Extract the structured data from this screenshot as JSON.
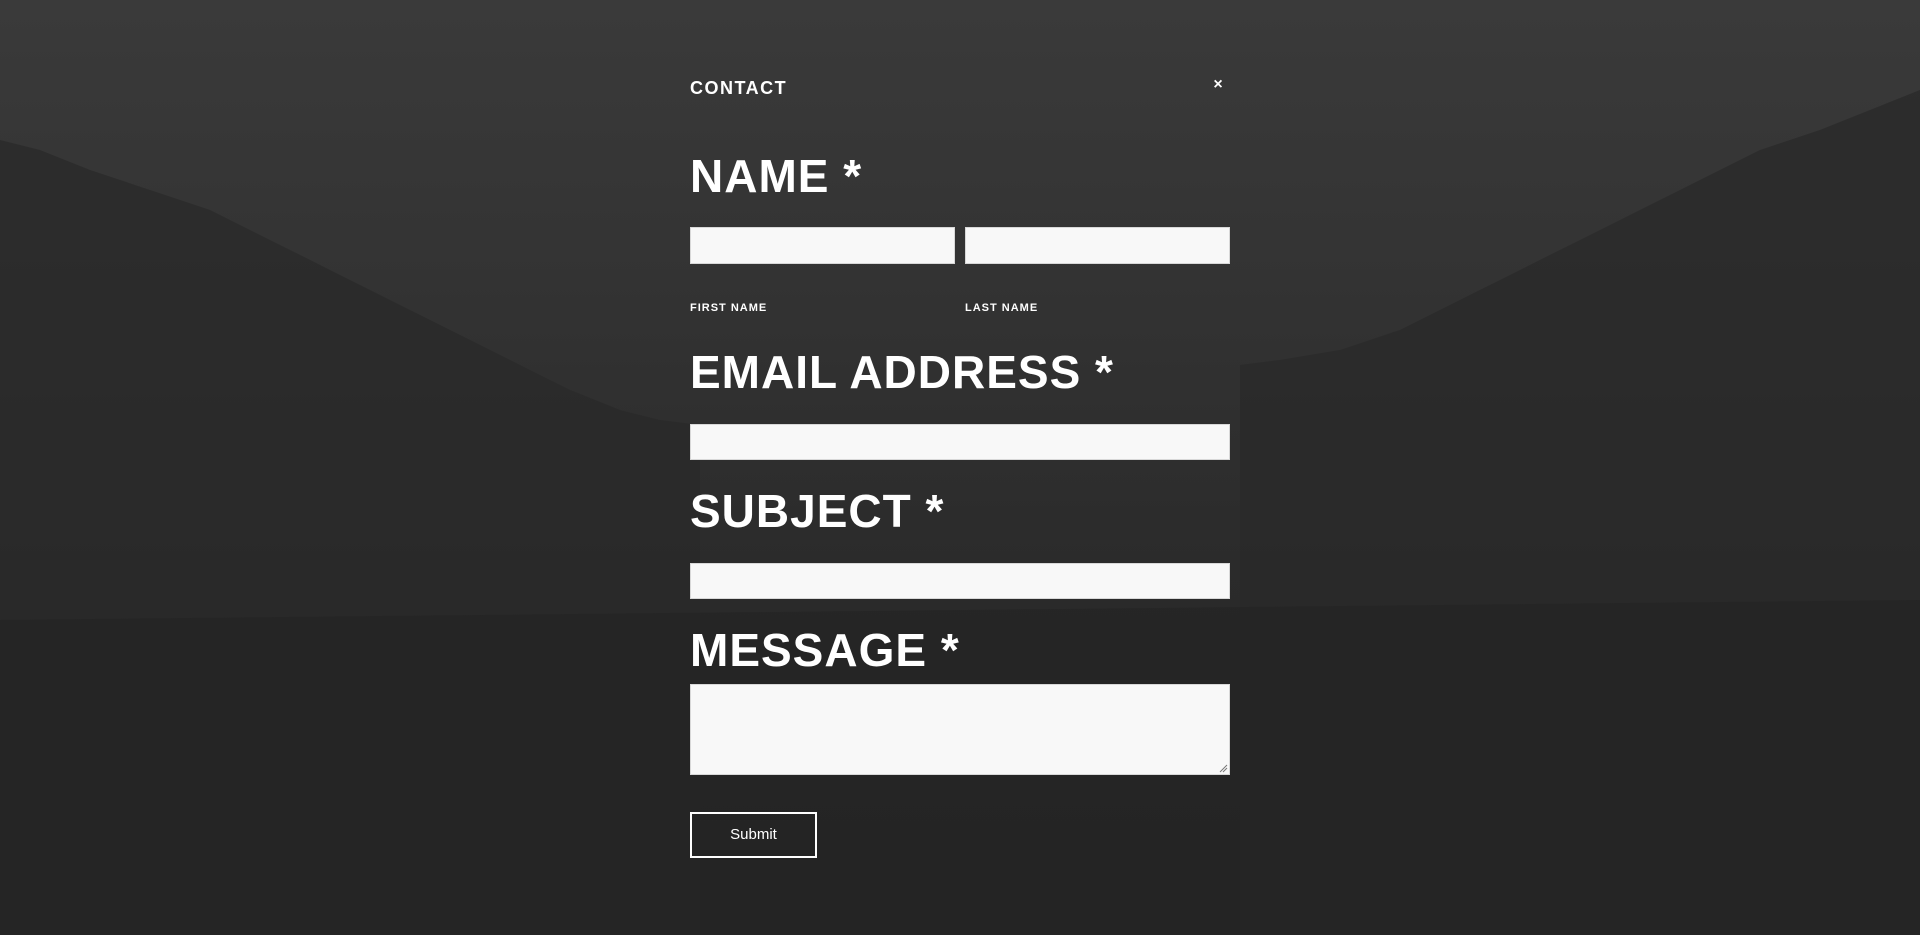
{
  "form": {
    "title": "CONTACT",
    "close_symbol": "×",
    "name": {
      "label": "NAME *",
      "first_label": "FIRST NAME",
      "last_label": "LAST NAME",
      "first_value": "",
      "last_value": ""
    },
    "email": {
      "label": "EMAIL ADDRESS *",
      "value": ""
    },
    "subject": {
      "label": "SUBJECT *",
      "value": ""
    },
    "message": {
      "label": "MESSAGE *",
      "value": ""
    },
    "submit_label": "Submit"
  },
  "colors": {
    "background": "#262626",
    "text": "#ffffff",
    "input": "#f8f8f8"
  }
}
